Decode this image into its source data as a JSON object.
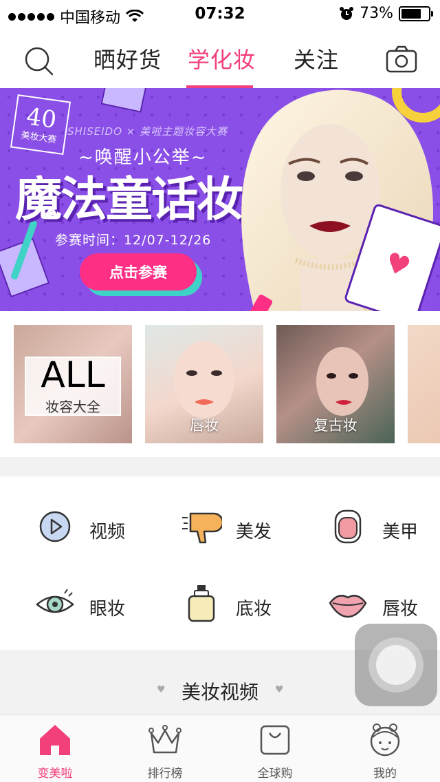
{
  "status_bar": {
    "carrier": "中国移动",
    "time": "07:32",
    "battery": "73%",
    "battery_level": 0.73
  },
  "nav": {
    "tabs": [
      {
        "label": "晒好货",
        "active": false
      },
      {
        "label": "学化妆",
        "active": true
      },
      {
        "label": "关注",
        "active": false
      }
    ],
    "accent_color": "#f2407a"
  },
  "banner": {
    "badge_number": "40",
    "badge_text": "美妆大赛",
    "brand_line": "SHISEIDO × 美啦主题妆容大赛",
    "subtitle": "~唤醒小公举~",
    "title": "魔法童话妆",
    "date_line": "参赛时间：12/07-12/26",
    "button_label": "点击参赛"
  },
  "categories": [
    {
      "big": "ALL",
      "label": "妆容大全"
    },
    {
      "label": "唇妆"
    },
    {
      "label": "复古妆"
    },
    {
      "label": ""
    }
  ],
  "grid": [
    {
      "label": "视频",
      "icon": "video-play-icon"
    },
    {
      "label": "美发",
      "icon": "hair-dryer-icon"
    },
    {
      "label": "美甲",
      "icon": "nail-icon"
    },
    {
      "label": "眼妆",
      "icon": "eye-icon"
    },
    {
      "label": "底妆",
      "icon": "foundation-bottle-icon"
    },
    {
      "label": "唇妆",
      "icon": "lips-icon"
    }
  ],
  "section": {
    "title": "美妆视频"
  },
  "tab_bar": [
    {
      "label": "变美啦",
      "icon": "home-icon",
      "active": true
    },
    {
      "label": "排行榜",
      "icon": "crown-icon",
      "active": false
    },
    {
      "label": "全球购",
      "icon": "shopping-bag-icon",
      "active": false
    },
    {
      "label": "我的",
      "icon": "profile-face-icon",
      "active": false
    }
  ]
}
